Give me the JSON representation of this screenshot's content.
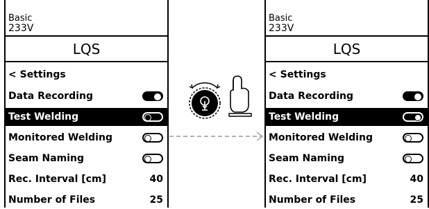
{
  "left": {
    "header": {
      "mode": "Basic",
      "voltage": "233V"
    },
    "title": "LQS",
    "back_label": "< Settings",
    "items": [
      {
        "label": "Data Recording",
        "toggle": "on",
        "selected": false
      },
      {
        "label": "Test Welding",
        "toggle": "off",
        "selected": true
      },
      {
        "label": "Monitored Welding",
        "toggle": "off",
        "selected": false
      },
      {
        "label": "Seam Naming",
        "toggle": "off",
        "selected": false
      },
      {
        "label": "Rec. Interval [cm]",
        "value": "40",
        "selected": false
      },
      {
        "label": "Number of Files",
        "value": "25",
        "selected": false
      }
    ]
  },
  "right": {
    "header": {
      "mode": "Basic",
      "voltage": "233V"
    },
    "title": "LQS",
    "back_label": "< Settings",
    "items": [
      {
        "label": "Data Recording",
        "toggle": "on",
        "selected": false
      },
      {
        "label": "Test Welding",
        "toggle": "on",
        "selected": true
      },
      {
        "label": "Monitored Welding",
        "toggle": "off",
        "selected": false
      },
      {
        "label": "Seam Naming",
        "toggle": "off",
        "selected": false
      },
      {
        "label": "Rec. Interval [cm]",
        "value": "40",
        "selected": false
      },
      {
        "label": "Number of Files",
        "value": "25",
        "selected": false
      }
    ]
  },
  "icons": [
    "rotary-knob-icon",
    "finger-press-icon",
    "dashed-arrow-icon"
  ]
}
